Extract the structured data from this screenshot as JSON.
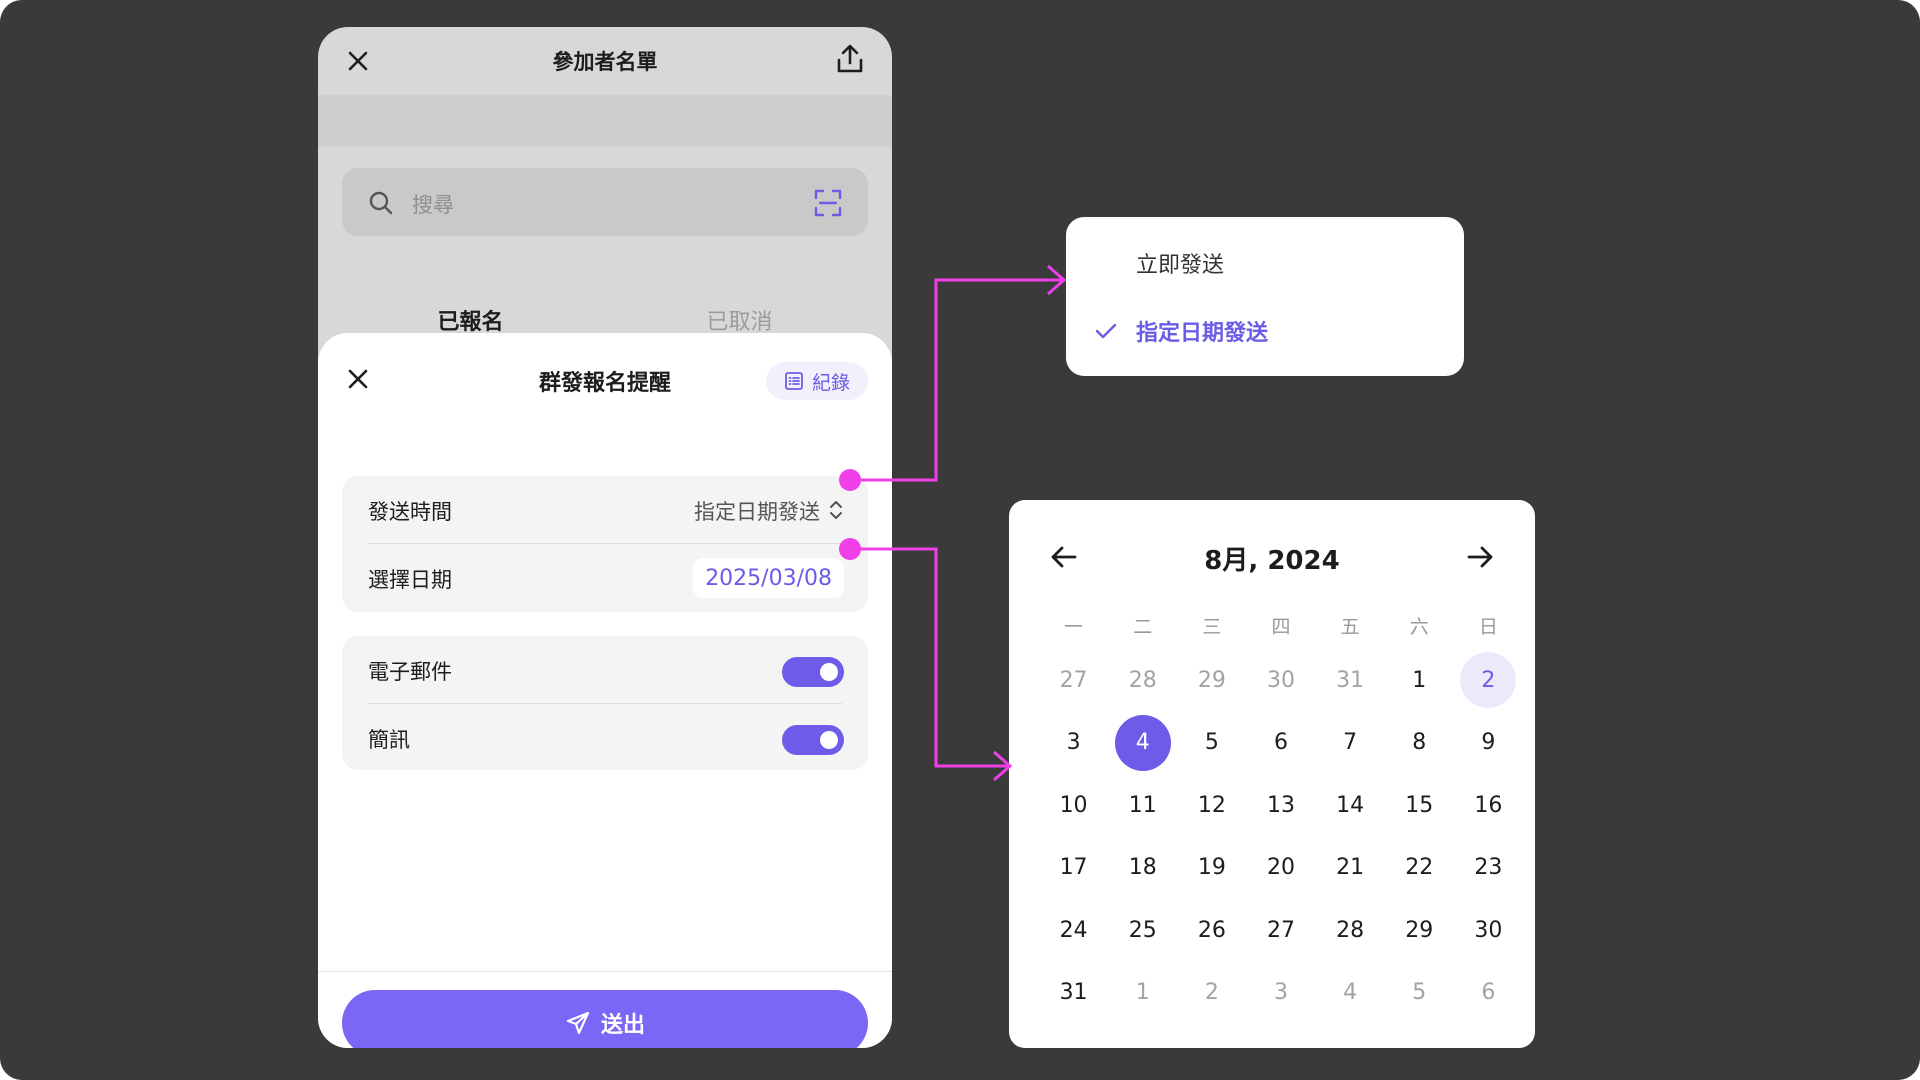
{
  "colors": {
    "accent": "#6c5ce7",
    "connector": "#f03ee8",
    "background": "#3a3a3a"
  },
  "phone": {
    "top_bar": {
      "title": "參加者名單",
      "close_icon": "close-icon",
      "share_icon": "share-icon"
    },
    "search": {
      "placeholder": "搜尋",
      "search_icon": "search-icon",
      "scan_icon": "scan-icon"
    },
    "tabs": [
      {
        "label": "已報名",
        "active": true
      },
      {
        "label": "已取消",
        "active": false
      }
    ],
    "sheet": {
      "title": "群發報名提醒",
      "records_label": "紀錄",
      "send_time": {
        "label": "發送時間",
        "value": "指定日期發送"
      },
      "select_date": {
        "label": "選擇日期",
        "value": "2025/03/08"
      },
      "email": {
        "label": "電子郵件",
        "enabled": true
      },
      "sms": {
        "label": "簡訊",
        "enabled": true
      },
      "send_button": "送出"
    }
  },
  "dropdown": {
    "options": [
      {
        "label": "立即發送",
        "selected": false
      },
      {
        "label": "指定日期發送",
        "selected": true
      }
    ]
  },
  "calendar": {
    "title": "8月, 2024",
    "weekdays": [
      "一",
      "二",
      "三",
      "四",
      "五",
      "六",
      "日"
    ],
    "weeks": [
      [
        {
          "d": "27",
          "m": true
        },
        {
          "d": "28",
          "m": true
        },
        {
          "d": "29",
          "m": true
        },
        {
          "d": "30",
          "m": true
        },
        {
          "d": "31",
          "m": true
        },
        {
          "d": "1"
        },
        {
          "d": "2",
          "today": true
        }
      ],
      [
        {
          "d": "3"
        },
        {
          "d": "4",
          "selected": true
        },
        {
          "d": "5"
        },
        {
          "d": "6"
        },
        {
          "d": "7"
        },
        {
          "d": "8"
        },
        {
          "d": "9"
        }
      ],
      [
        {
          "d": "10"
        },
        {
          "d": "11"
        },
        {
          "d": "12"
        },
        {
          "d": "13"
        },
        {
          "d": "14"
        },
        {
          "d": "15"
        },
        {
          "d": "16"
        }
      ],
      [
        {
          "d": "17"
        },
        {
          "d": "18"
        },
        {
          "d": "19"
        },
        {
          "d": "20"
        },
        {
          "d": "21"
        },
        {
          "d": "22"
        },
        {
          "d": "23"
        }
      ],
      [
        {
          "d": "24"
        },
        {
          "d": "25"
        },
        {
          "d": "26"
        },
        {
          "d": "27"
        },
        {
          "d": "28"
        },
        {
          "d": "29"
        },
        {
          "d": "30"
        }
      ],
      [
        {
          "d": "31"
        },
        {
          "d": "1",
          "m": true
        },
        {
          "d": "2",
          "m": true
        },
        {
          "d": "3",
          "m": true
        },
        {
          "d": "4",
          "m": true
        },
        {
          "d": "5",
          "m": true
        },
        {
          "d": "6",
          "m": true
        }
      ]
    ]
  }
}
